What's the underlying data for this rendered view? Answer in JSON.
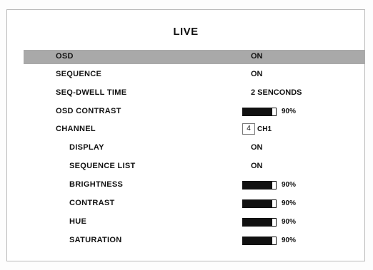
{
  "menu": {
    "title": "LIVE",
    "osd": {
      "label": "OSD",
      "value": "ON"
    },
    "sequence": {
      "label": "SEQUENCE",
      "value": "ON"
    },
    "seq_dwell_time": {
      "label": "SEQ-DWELL TIME",
      "value": "2 SENCONDS"
    },
    "osd_contrast": {
      "label": "OSD CONTRAST",
      "value": "90%",
      "level": 0.9
    },
    "channel": {
      "label": "CHANNEL",
      "number": "4",
      "name": "CH1"
    },
    "display": {
      "label": "DISPLAY",
      "value": "ON"
    },
    "sequence_list": {
      "label": "SEQUENCE LIST",
      "value": "ON"
    },
    "brightness": {
      "label": "BRIGHTNESS",
      "value": "90%",
      "level": 0.9
    },
    "contrast": {
      "label": "CONTRAST",
      "value": "90%",
      "level": 0.9
    },
    "hue": {
      "label": "HUE",
      "value": "90%",
      "level": 0.9
    },
    "saturation": {
      "label": "SATURATION",
      "value": "90%",
      "level": 0.9
    }
  },
  "colors": {
    "selection": "#a9a9a9",
    "bar_fill": "#111111"
  }
}
